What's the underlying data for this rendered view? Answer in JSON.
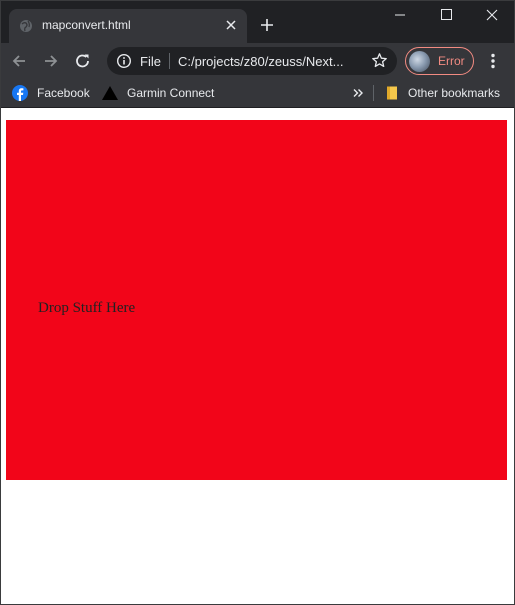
{
  "browser": {
    "tab": {
      "title": "mapconvert.html"
    },
    "omnibox": {
      "scheme_label": "File",
      "url": "C:/projects/z80/zeuss/Next..."
    },
    "profile": {
      "status": "Error"
    },
    "bookmarks": [
      {
        "label": "Facebook",
        "icon": "facebook-icon"
      },
      {
        "label": "Garmin Connect",
        "icon": "garmin-triangle-icon"
      }
    ],
    "other_bookmarks_label": "Other bookmarks"
  },
  "page": {
    "dropzone_text": "Drop Stuff Here"
  },
  "colors": {
    "chrome_dark": "#202124",
    "chrome_toolbar": "#35363a",
    "text": "#e8eaed",
    "error": "#f28b82",
    "dropzone": "#f20519",
    "facebook": "#1877f2",
    "folder": "#f6c84b"
  }
}
